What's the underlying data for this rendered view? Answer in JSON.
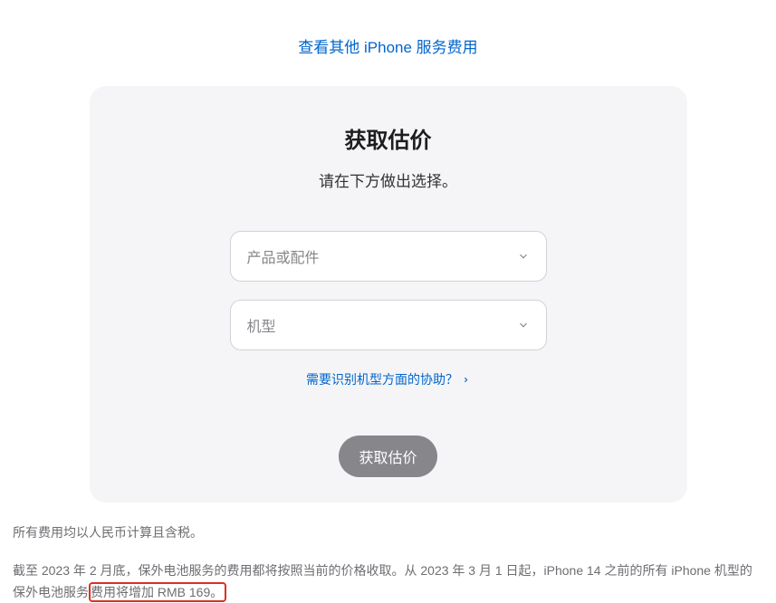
{
  "topLink": "查看其他 iPhone 服务费用",
  "card": {
    "title": "获取估价",
    "subtitle": "请在下方做出选择。",
    "select1": {
      "placeholder": "产品或配件"
    },
    "select2": {
      "placeholder": "机型"
    },
    "helpLink": "需要识别机型方面的协助？",
    "button": "获取估价"
  },
  "footer": {
    "line1": "所有费用均以人民币计算且含税。",
    "line2_before": "截至 2023 年 2 月底，保外电池服务的费用都将按照当前的价格收取。从 2023 年 3 月 1 日起，iPhone 14 之前的所有 iPhone 机型的保外电池服务",
    "line2_highlight": "费用将增加 RMB 169。"
  }
}
